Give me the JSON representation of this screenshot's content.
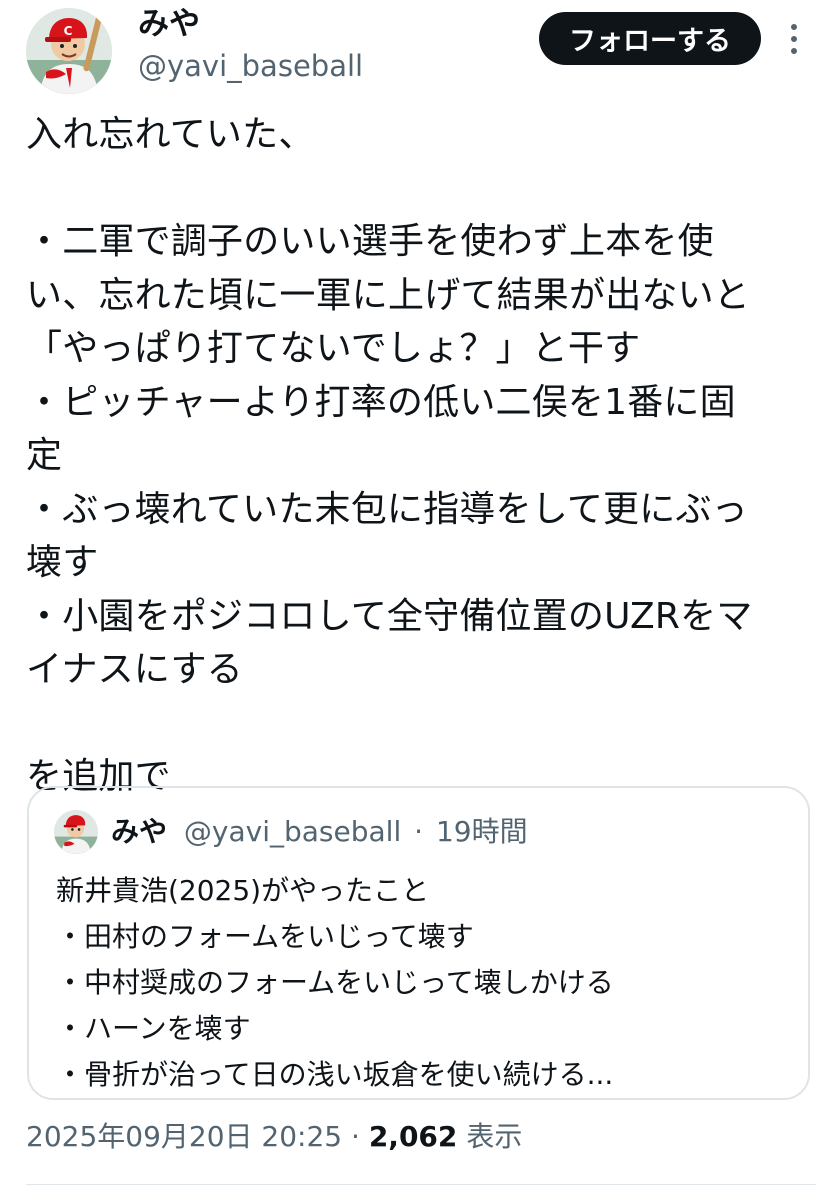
{
  "tweet": {
    "author": {
      "name": "みや",
      "handle": "@yavi_baseball",
      "avatar_icon": "baseball-player-avatar-icon"
    },
    "follow_label": "フォローする",
    "more_icon": "more-options-icon",
    "text": "入れ忘れていた、\n\n・二軍で調子のいい選手を使わず上本を使\nい、忘れた頃に一軍に上げて結果が出ないと\n「やっぱり打てないでしょ？」と干す\n・ピッチャーより打率の低い二俣を1番に固\n定\n・ぶっ壊れていた末包に指導をして更にぶっ\n壊す\n・小園をポジコロして全守備位置のUZRをマ\nイナスにする\n\nを追加で",
    "quoted": {
      "name": "みや",
      "handle": "@yavi_baseball",
      "separator": "·",
      "time": "19時間",
      "text": "新井貴浩(2025)がやったこと\n・田村のフォームをいじって壊す\n・中村奨成のフォームをいじって壊しかける\n・ハーンを壊す\n・骨折が治って日の浅い坂倉を使い続ける..."
    },
    "footer": {
      "datetime": "2025年09月20日 20:25",
      "separator": "·",
      "views": "2,062",
      "views_label": "表示"
    }
  },
  "colors": {
    "text": "#0f1419",
    "secondary": "#536471",
    "button_bg": "#0f1419",
    "border": "#dfe4e8",
    "avatar_red": "#d7141a"
  }
}
